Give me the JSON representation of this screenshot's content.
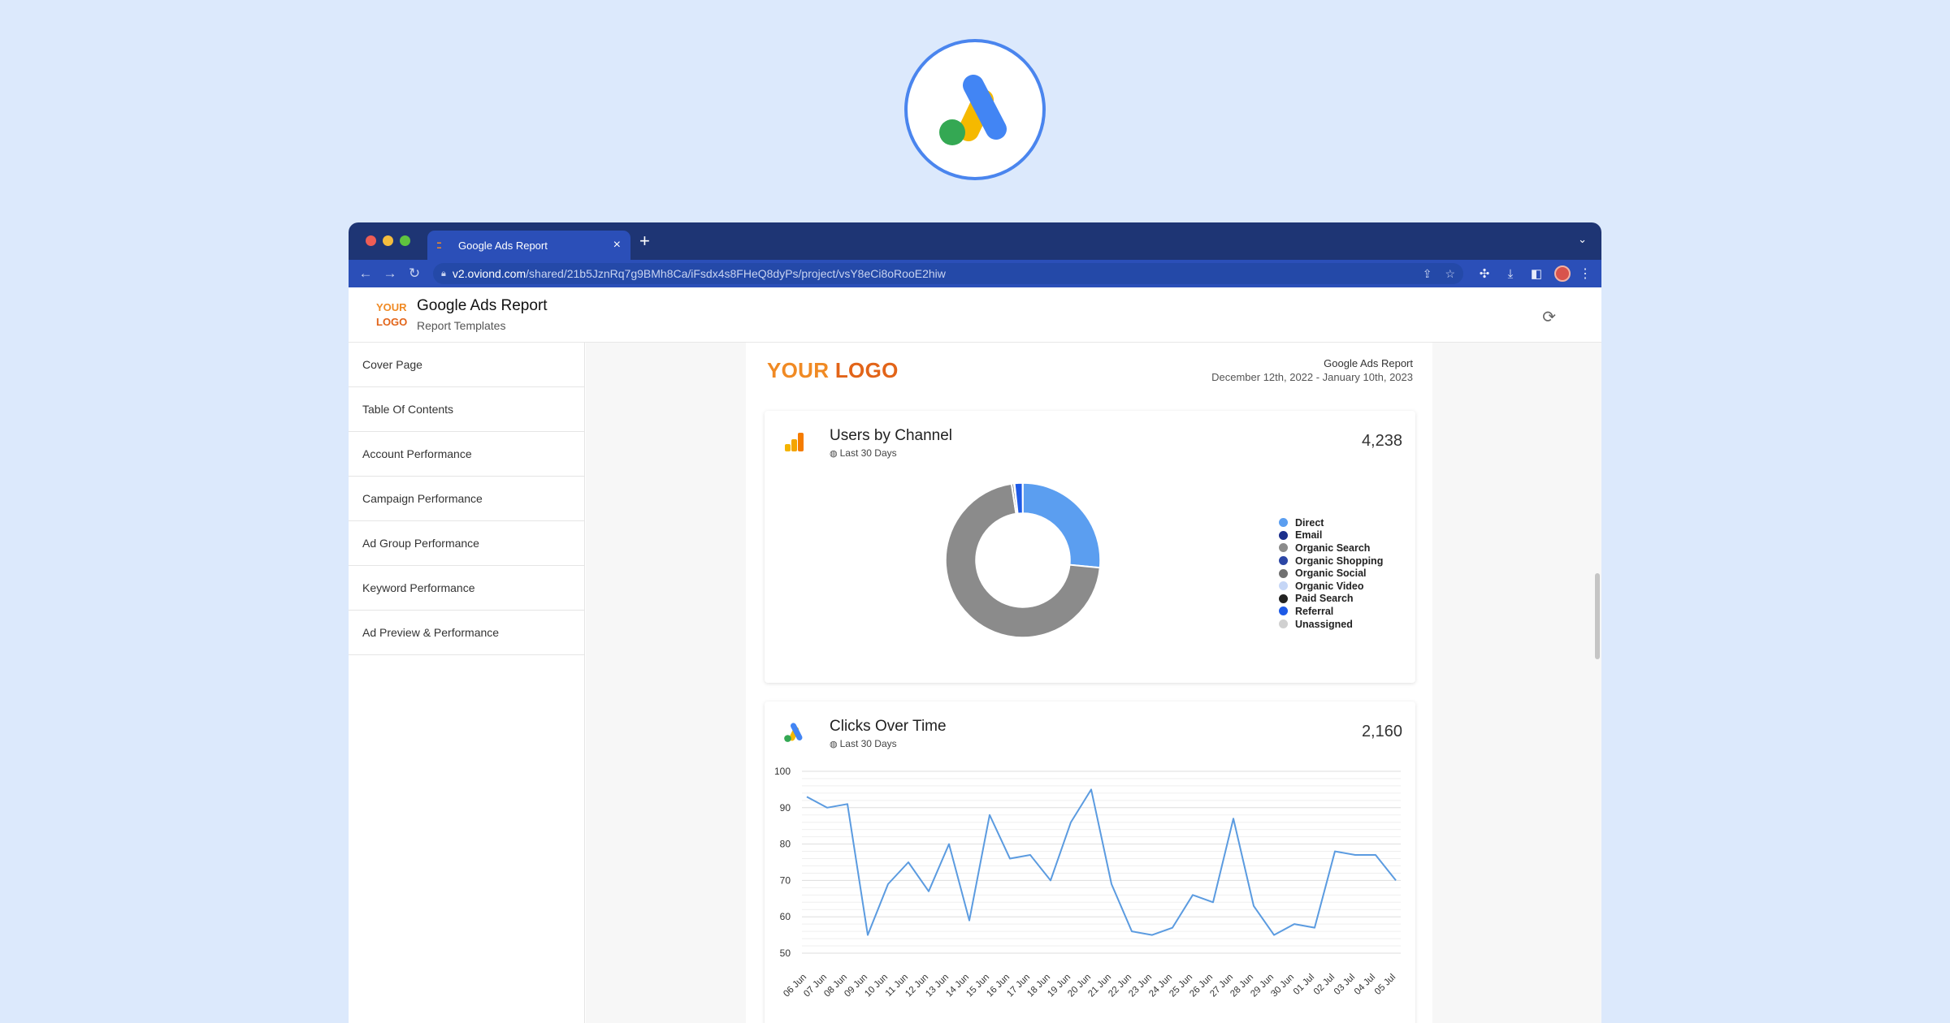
{
  "badge": {
    "icon": "google-ads-logo-icon"
  },
  "browser": {
    "tab_title": "Google Ads Report",
    "url_host": "v2.oviond.com",
    "url_path": "/shared/21b5JznRq7g9BMh8Ca/iFsdx4s8FHeQ8dyPs/project/vsY8eCi8oRooE2hiw"
  },
  "header": {
    "logo_line1": "YOUR",
    "logo_line2": "LOGO",
    "title": "Google Ads Report",
    "subtitle": "Report Templates"
  },
  "sidebar": {
    "items": [
      {
        "label": "Cover Page"
      },
      {
        "label": "Table Of Contents"
      },
      {
        "label": "Account Performance"
      },
      {
        "label": "Campaign Performance"
      },
      {
        "label": "Ad Group Performance"
      },
      {
        "label": "Keyword Performance"
      },
      {
        "label": "Ad Preview & Performance"
      }
    ]
  },
  "report_page": {
    "logo_word1": "YOUR",
    "logo_word2": "LOGO",
    "title": "Google Ads Report",
    "date_range": "December 12th, 2022 - January 10th, 2023"
  },
  "widgets": {
    "users_by_channel": {
      "title": "Users by Channel",
      "period": "Last 30 Days",
      "total": "4,238",
      "icon": "analytics-bar-icon"
    },
    "clicks_over_time": {
      "title": "Clicks Over Time",
      "period": "Last 30 Days",
      "total": "2,160",
      "icon": "google-ads-icon"
    }
  },
  "chart_data": [
    {
      "type": "pie",
      "title": "Users by Channel",
      "donut": true,
      "legend_placement": "right",
      "series": [
        {
          "name": "Direct",
          "value": 26.5,
          "color": "#5b9ef0"
        },
        {
          "name": "Email",
          "value": 0.1,
          "color": "#1c2f8c"
        },
        {
          "name": "Organic Search",
          "value": 71.0,
          "color": "#8b8b8b"
        },
        {
          "name": "Organic Shopping",
          "value": 0.1,
          "color": "#2c46a5"
        },
        {
          "name": "Organic Social",
          "value": 0.4,
          "color": "#707070"
        },
        {
          "name": "Organic Video",
          "value": 0.1,
          "color": "#c5d6f6"
        },
        {
          "name": "Paid Search",
          "value": 0.1,
          "color": "#222222"
        },
        {
          "name": "Referral",
          "value": 1.6,
          "color": "#1e5ae6"
        },
        {
          "name": "Unassigned",
          "value": 0.1,
          "color": "#d0d0d0"
        }
      ]
    },
    {
      "type": "line",
      "title": "Clicks Over Time",
      "ylim": [
        50,
        100
      ],
      "yticks": [
        50,
        60,
        70,
        80,
        90,
        100
      ],
      "grid": true,
      "legend_placement": "bottom",
      "categories": [
        "06 Jun",
        "07 Jun",
        "08 Jun",
        "09 Jun",
        "10 Jun",
        "11 Jun",
        "12 Jun",
        "13 Jun",
        "14 Jun",
        "15 Jun",
        "16 Jun",
        "17 Jun",
        "18 Jun",
        "19 Jun",
        "20 Jun",
        "21 Jun",
        "22 Jun",
        "23 Jun",
        "24 Jun",
        "25 Jun",
        "26 Jun",
        "27 Jun",
        "28 Jun",
        "29 Jun",
        "30 Jun",
        "01 Jul",
        "02 Jul",
        "03 Jul",
        "04 Jul",
        "05 Jul"
      ],
      "series": [
        {
          "name": "Clicks",
          "color": "#5b9be0",
          "values": [
            93,
            90,
            91,
            55,
            69,
            75,
            67,
            80,
            59,
            88,
            76,
            77,
            70,
            86,
            95,
            69,
            56,
            55,
            57,
            66,
            64,
            87,
            63,
            55,
            58,
            57,
            78,
            77,
            77,
            70
          ]
        }
      ]
    }
  ]
}
